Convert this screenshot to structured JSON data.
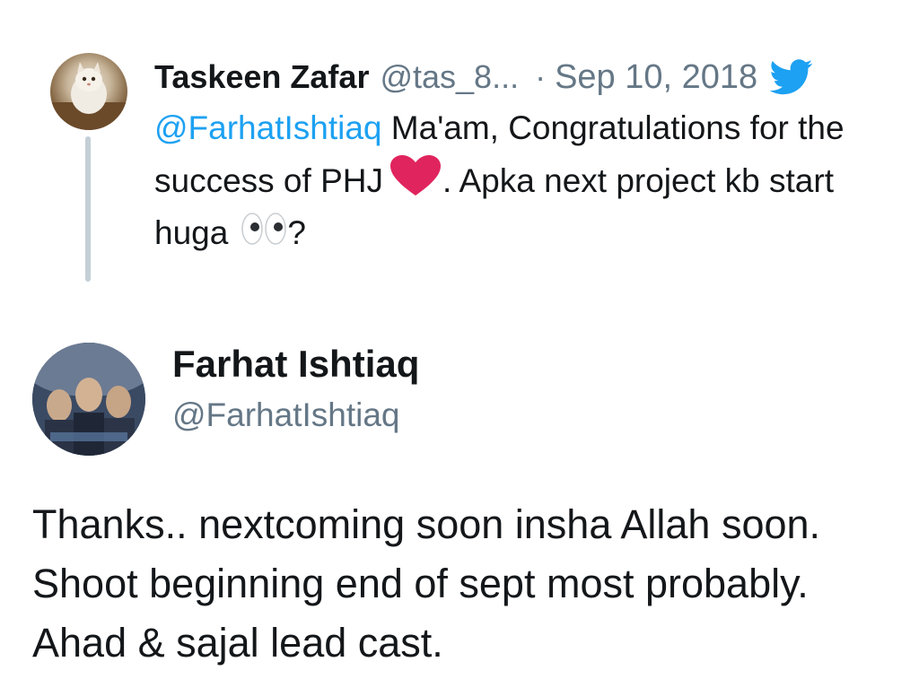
{
  "parent": {
    "author_name": "Taskeen Zafar",
    "author_handle": "@tas_8...",
    "separator": "·",
    "date": "Sep 10, 2018",
    "platform_icon": "twitter-bird-icon",
    "mention": "@FarhatIshtiaq",
    "text_1": " Ma'am, Congratulations for the success of PHJ",
    "heart_emoji": "red-heart-icon",
    "text_2": ". Apka next project kb start huga",
    "eyes_emoji": "eyes-icon",
    "text_3": "?",
    "colors": {
      "mention": "#1da1f2",
      "secondary": "#657786",
      "thread_line": "#c4cfd6",
      "twitter_blue": "#1da1f2",
      "heart": "#e0245e"
    }
  },
  "reply": {
    "author_name": "Farhat Ishtiaq",
    "author_handle": "@FarhatIshtiaq",
    "body": "Thanks.. nextcoming soon insha Allah soon. Shoot beginning end of sept most probably. Ahad & sajal lead cast."
  }
}
